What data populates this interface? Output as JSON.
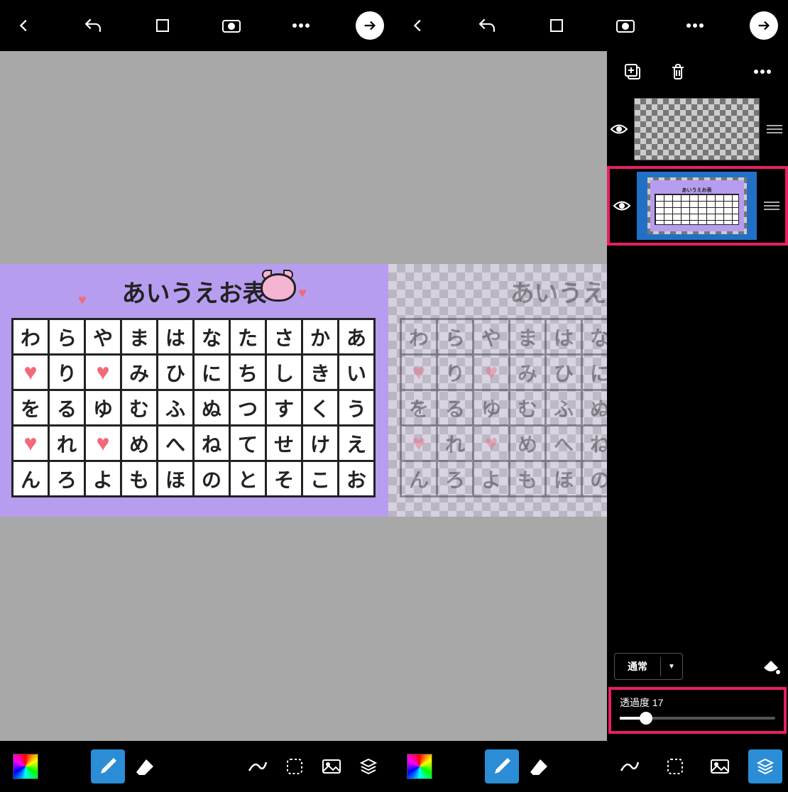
{
  "toolbar": {
    "back_icon": "chevron-left",
    "undo_icon": "undo",
    "crop_icon": "crop",
    "camera_icon": "camera",
    "more_icon": "more",
    "next_icon": "arrow-right"
  },
  "artwork": {
    "title": "あいうえお表",
    "grid": [
      [
        "わ",
        "ら",
        "や",
        "ま",
        "は",
        "な",
        "た",
        "さ",
        "か",
        "あ"
      ],
      [
        "♥",
        "り",
        "♥",
        "み",
        "ひ",
        "に",
        "ち",
        "し",
        "き",
        "い"
      ],
      [
        "を",
        "る",
        "ゆ",
        "む",
        "ふ",
        "ぬ",
        "つ",
        "す",
        "く",
        "う"
      ],
      [
        "♥",
        "れ",
        "♥",
        "め",
        "へ",
        "ね",
        "て",
        "せ",
        "け",
        "え"
      ],
      [
        "ん",
        "ろ",
        "よ",
        "も",
        "ほ",
        "の",
        "と",
        "そ",
        "こ",
        "お"
      ]
    ]
  },
  "layers": {
    "add_icon": "add-layer",
    "delete_icon": "trash",
    "more_icon": "more",
    "items": [
      {
        "visible": true,
        "selected": false,
        "content": "transparent"
      },
      {
        "visible": true,
        "selected": true,
        "content": "artwork"
      }
    ],
    "blend_mode": "通常",
    "opacity_label": "透過度",
    "opacity_value": 17
  },
  "footer": {
    "color": "rainbow",
    "tools": [
      "brush",
      "eraser"
    ],
    "active_tool": "brush",
    "right_tools": [
      "curve",
      "lasso",
      "image",
      "layers"
    ],
    "rightpanel_tools": [
      "curve",
      "lasso",
      "image",
      "layers"
    ],
    "rightpanel_active": "layers"
  }
}
